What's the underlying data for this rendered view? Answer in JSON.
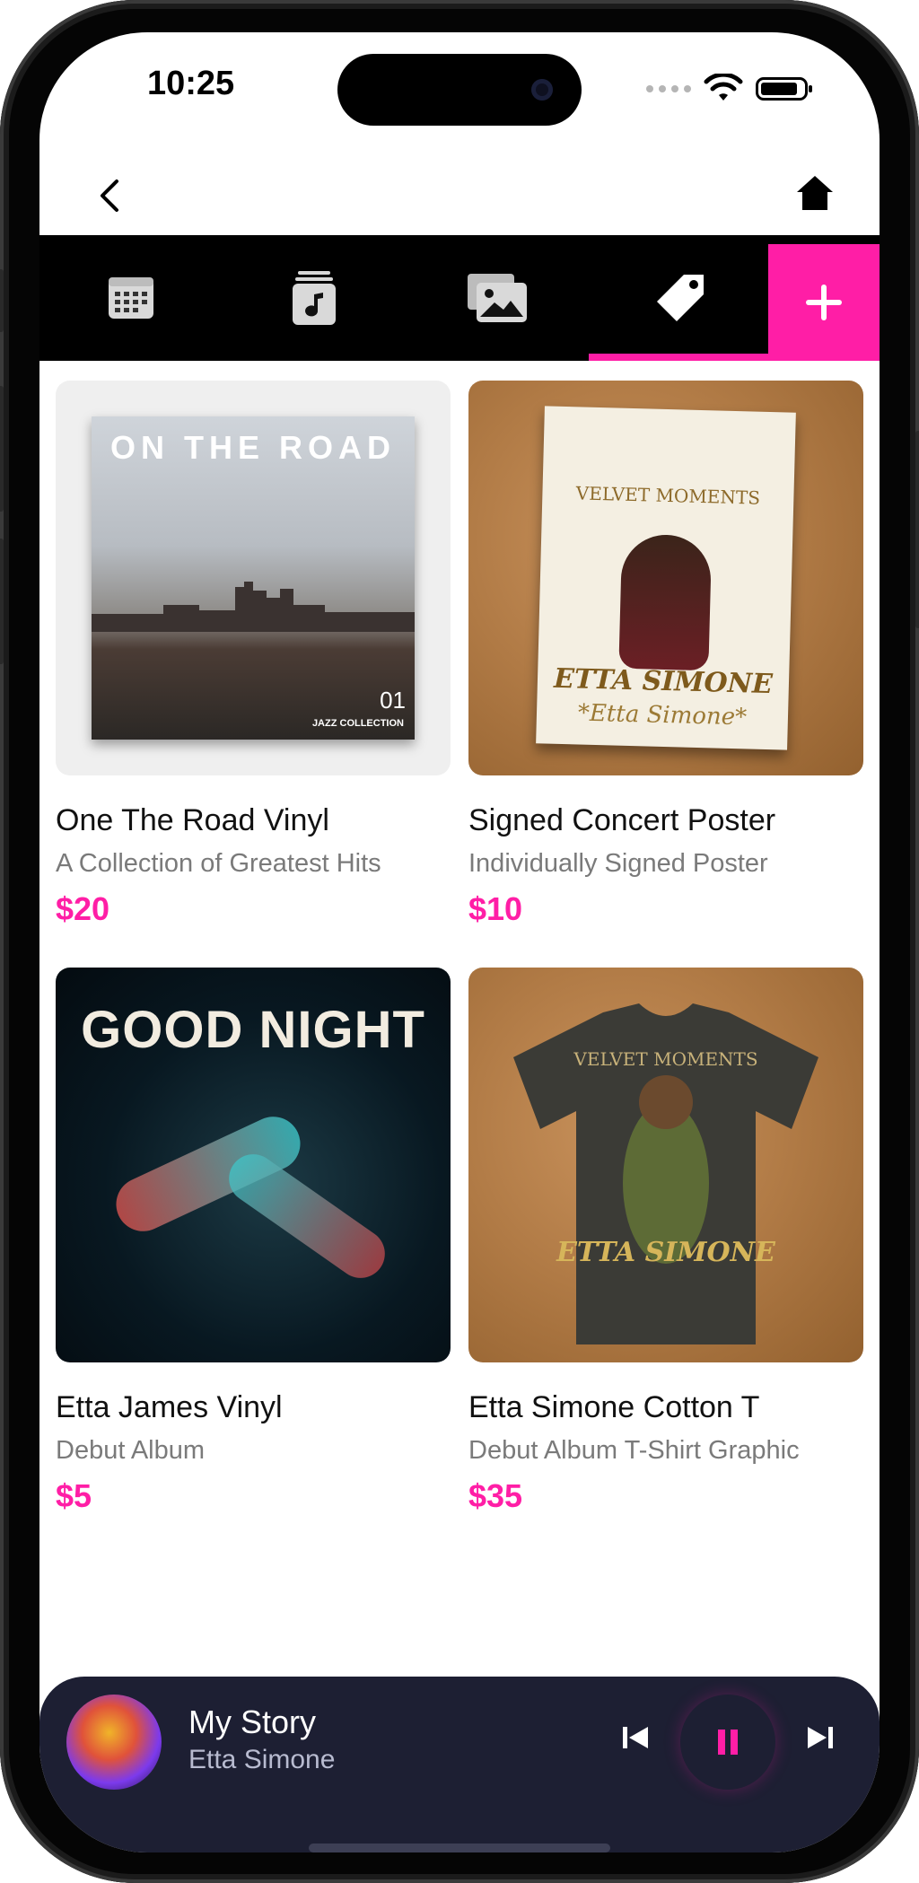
{
  "status_bar": {
    "time": "10:25"
  },
  "nav": {
    "back_icon": "chevron-left-icon",
    "home_icon": "home-icon"
  },
  "tabs": [
    {
      "id": "events",
      "icon": "calendar-icon",
      "active": false
    },
    {
      "id": "music",
      "icon": "music-note-icon",
      "active": false
    },
    {
      "id": "gallery",
      "icon": "photos-icon",
      "active": false
    },
    {
      "id": "store",
      "icon": "tag-icon",
      "active": true
    },
    {
      "id": "add",
      "icon": "plus-icon",
      "active": false
    }
  ],
  "colors": {
    "accent": "#ff1ea6",
    "player_bg": "#1d1f33"
  },
  "products": [
    {
      "title": "One The Road Vinyl",
      "subtitle": "A Collection of Greatest Hits",
      "price": "$20",
      "art": {
        "headline": "ON THE ROAD",
        "number": "01",
        "caption": "JAZZ COLLECTION"
      }
    },
    {
      "title": "Signed Concert Poster",
      "subtitle": "Individually Signed Poster",
      "price": "$10",
      "art": {
        "headline": "VELVET MOMENTS",
        "name": "ETTA SIMONE",
        "signature": "*Etta Simone*"
      }
    },
    {
      "title": "Etta James Vinyl",
      "subtitle": "Debut Album",
      "price": "$5",
      "art": {
        "headline": "GOOD NIGHT"
      }
    },
    {
      "title": "Etta Simone Cotton T",
      "subtitle": "Debut Album T-Shirt Graphic",
      "price": "$35",
      "art": {
        "headline": "VELVET MOMENTS",
        "name": "ETTA SIMONE"
      }
    }
  ],
  "player": {
    "song": "My Story",
    "artist": "Etta Simone",
    "state": "playing"
  }
}
